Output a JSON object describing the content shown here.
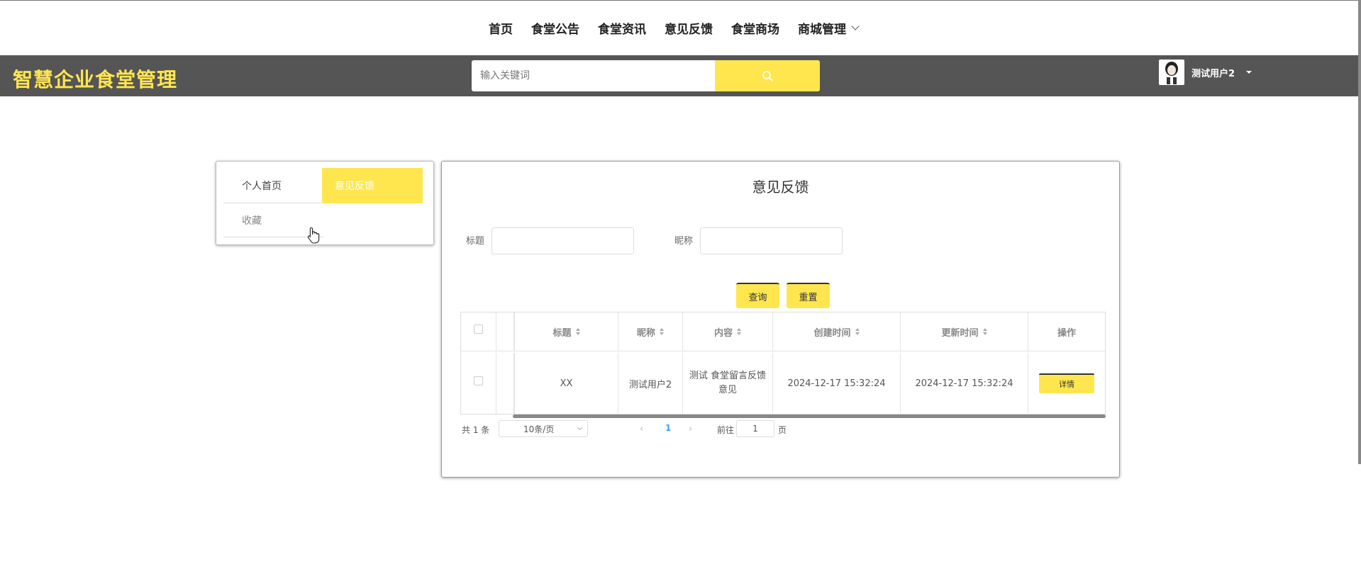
{
  "topnav": {
    "items": [
      {
        "label": "首页"
      },
      {
        "label": "食堂公告"
      },
      {
        "label": "食堂资讯"
      },
      {
        "label": "意见反馈"
      },
      {
        "label": "食堂商场"
      },
      {
        "label": "商城管理"
      }
    ]
  },
  "header": {
    "brand": "智慧企业食堂管理",
    "search": {
      "placeholder": "输入关键词",
      "value": ""
    },
    "user": {
      "name": "测试用户2"
    }
  },
  "sidebar": {
    "items": [
      {
        "label": "个人首页"
      },
      {
        "label": "意见反馈",
        "active": true
      },
      {
        "label": "收藏"
      }
    ]
  },
  "main": {
    "title": "意见反馈",
    "filters": {
      "title_label": "标题",
      "nickname_label": "昵称",
      "query_label": "查询",
      "reset_label": "重置"
    },
    "table": {
      "columns": [
        "标题",
        "昵称",
        "内容",
        "创建时间",
        "更新时间",
        "操作"
      ],
      "rows": [
        {
          "title": "XX",
          "nickname": "测试用户2",
          "content": "测试 食堂留言反馈意见",
          "created": "2024-12-17 15:32:24",
          "updated": "2024-12-17 15:32:24",
          "action": "详情"
        }
      ]
    },
    "pagination": {
      "total": "共 1 条",
      "page_size": "10条/页",
      "current_page": "1",
      "goto_label": "前往",
      "goto_value": "1",
      "page_suffix": "页"
    }
  },
  "colors": {
    "accent": "#ffe64f",
    "header_bg": "#555555",
    "link": "#409eff"
  }
}
